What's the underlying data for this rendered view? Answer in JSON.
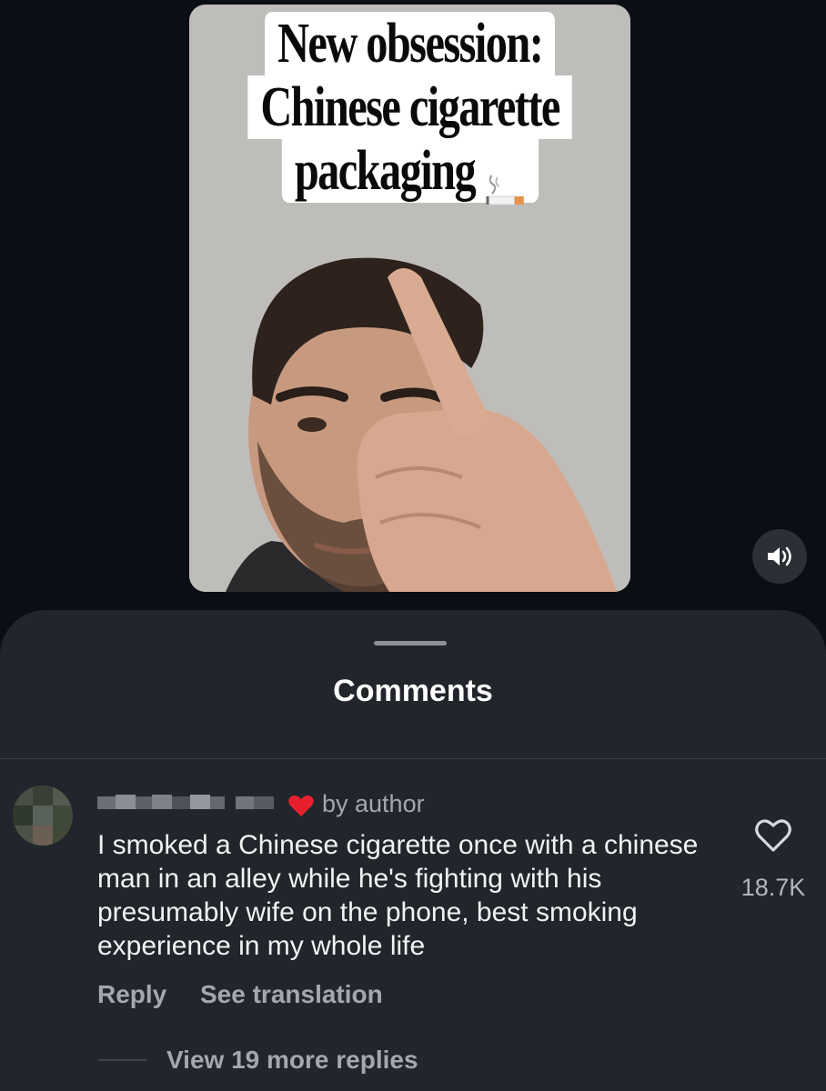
{
  "video": {
    "caption_line1": "New obsession:",
    "caption_line2": "Chinese cigarette",
    "caption_line3": "packaging",
    "caption_emoji": "cigarette-emoji",
    "sound_icon": "speaker-icon"
  },
  "comments": {
    "title": "Comments",
    "items": [
      {
        "username": "",
        "badge_icon": "red-heart-icon",
        "badge_text": "by author",
        "text": "I smoked a Chinese cigarette once with a chinese man in an alley while he's fighting with his presumably wife on the phone, best smoking experience in my whole life",
        "like_icon": "heart-outline-icon",
        "like_count": "18.7K",
        "reply_label": "Reply",
        "translate_label": "See translation",
        "view_replies_label": "View 19 more replies"
      }
    ]
  },
  "colors": {
    "background": "#0b0e14",
    "sheet": "#22252b",
    "text_primary": "#f1f2f4",
    "text_secondary": "#a3a8b0",
    "heart_red": "#e8202e"
  }
}
